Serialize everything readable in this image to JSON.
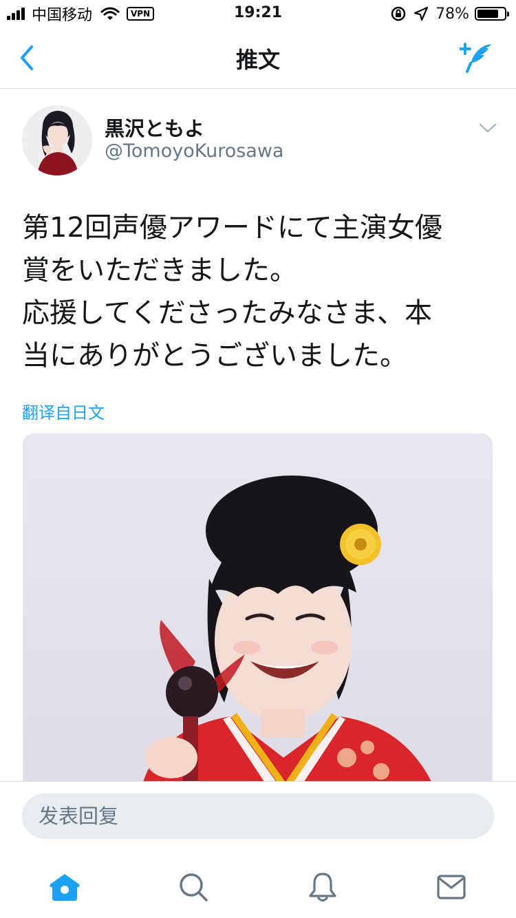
{
  "status_bar": {
    "carrier": "中国移动",
    "vpn": "VPN",
    "time": "19:21",
    "battery_text": "78%",
    "battery_level": 0.78
  },
  "nav": {
    "title": "推文"
  },
  "tweet": {
    "display_name": "黒沢ともよ",
    "handle": "@TomoyoKurosawa",
    "text": "第12回声優アワードにて主演女優\n賞をいただきました。\n応援してくださったみなさま、本\n当にありがとうございました。",
    "translate_label": "翻译自日文"
  },
  "reply": {
    "placeholder": "发表回复"
  },
  "colors": {
    "accent": "#1da1f2",
    "text": "#14171a",
    "muted": "#657786",
    "divider": "#d8dde2",
    "input_bg": "#e6ecf0"
  }
}
